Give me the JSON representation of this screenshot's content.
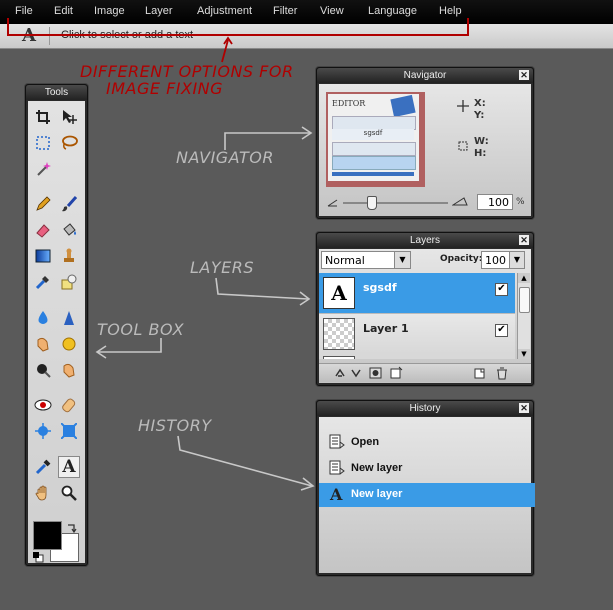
{
  "menu": [
    "File",
    "Edit",
    "Image",
    "Layer",
    "Adjustment",
    "Filter",
    "View",
    "Language",
    "Help"
  ],
  "options_bar": {
    "tool_glyph": "A",
    "hint": "Click to select or add a text"
  },
  "annotations": {
    "options_line1": "DIFFERENT OPTIONS FOR",
    "options_line2": "IMAGE FIXING",
    "navigator": "NAVIGATOR",
    "layers": "LAYERS",
    "toolbox": "TOOL BOX",
    "history": "HISTORY"
  },
  "tools": {
    "title": "Tools"
  },
  "navigator": {
    "title": "Navigator",
    "x_label": "X:",
    "y_label": "Y:",
    "w_label": "W:",
    "h_label": "H:",
    "zoom": "100",
    "zoom_unit": "%",
    "thumb_text": "sgsdf",
    "thumb_logo": "EDITOR"
  },
  "layers": {
    "title": "Layers",
    "blend_mode": "Normal",
    "opacity_label": "Opacity:",
    "opacity": "100",
    "items": [
      {
        "name": "sgsdf",
        "type": "text",
        "glyph": "A"
      },
      {
        "name": "Layer 1",
        "type": "raster"
      }
    ]
  },
  "history": {
    "title": "History",
    "items": [
      {
        "label": "Open"
      },
      {
        "label": "New layer"
      },
      {
        "label": "New layer"
      }
    ]
  },
  "colors": {
    "accent": "#3b9ee8",
    "annotation_red": "#b00000",
    "primary_color": "#000000",
    "secondary_color": "#ffffff"
  }
}
